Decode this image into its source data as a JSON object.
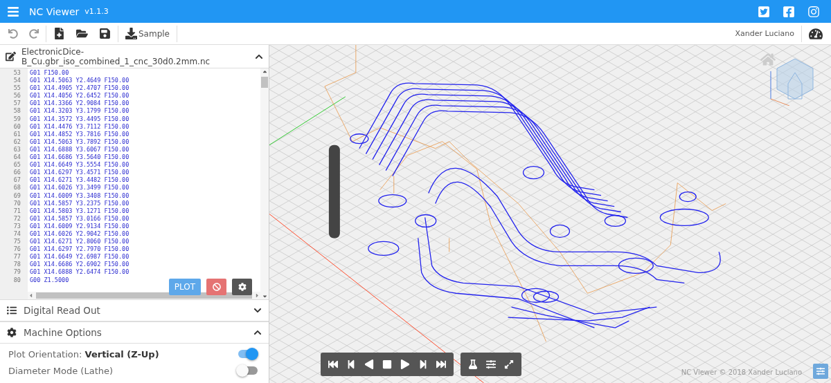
{
  "app_bar": {
    "title": "NC Viewer",
    "version": "v1.1.3"
  },
  "toolbar": {
    "sample_label": "Sample",
    "user": "Xander Luciano"
  },
  "editor": {
    "file_name": "ElectronicDice-B_Cu.gbr_iso_combined_1_cnc_30d0.2mm.nc",
    "plot_button": "PLOT",
    "lines": [
      {
        "number": "53",
        "code": "G01 F150.00"
      },
      {
        "number": "54",
        "code": "G01 X14.5063 Y2.4649 F150.00"
      },
      {
        "number": "55",
        "code": "G01 X14.4905 Y2.4707 F150.00"
      },
      {
        "number": "56",
        "code": "G01 X14.4056 Y2.6452 F150.00"
      },
      {
        "number": "57",
        "code": "G01 X14.3366 Y2.9084 F150.00"
      },
      {
        "number": "58",
        "code": "G01 X14.3203 Y3.1799 F150.00"
      },
      {
        "number": "59",
        "code": "G01 X14.3572 Y3.4495 F150.00"
      },
      {
        "number": "60",
        "code": "G01 X14.4476 Y3.7112 F150.00"
      },
      {
        "number": "61",
        "code": "G01 X14.4852 Y3.7816 F150.00"
      },
      {
        "number": "62",
        "code": "G01 X14.5063 Y3.7892 F150.00"
      },
      {
        "number": "63",
        "code": "G01 X14.6888 Y3.6067 F150.00"
      },
      {
        "number": "64",
        "code": "G01 X14.6686 Y3.5640 F150.00"
      },
      {
        "number": "65",
        "code": "G01 X14.6649 Y3.5554 F150.00"
      },
      {
        "number": "66",
        "code": "G01 X14.6297 Y3.4571 F150.00"
      },
      {
        "number": "67",
        "code": "G01 X14.6271 Y3.4482 F150.00"
      },
      {
        "number": "68",
        "code": "G01 X14.6026 Y3.3499 F150.00"
      },
      {
        "number": "69",
        "code": "G01 X14.6009 Y3.3408 F150.00"
      },
      {
        "number": "70",
        "code": "G01 X14.5857 Y3.2375 F150.00"
      },
      {
        "number": "71",
        "code": "G01 X14.5803 Y3.1271 F150.00"
      },
      {
        "number": "72",
        "code": "G01 X14.5857 Y3.0166 F150.00"
      },
      {
        "number": "73",
        "code": "G01 X14.6009 Y2.9134 F150.00"
      },
      {
        "number": "74",
        "code": "G01 X14.6026 Y2.9042 F150.00"
      },
      {
        "number": "75",
        "code": "G01 X14.6271 Y2.8060 F150.00"
      },
      {
        "number": "76",
        "code": "G01 X14.6297 Y2.7970 F150.00"
      },
      {
        "number": "77",
        "code": "G01 X14.6649 Y2.6987 F150.00"
      },
      {
        "number": "78",
        "code": "G01 X14.6686 Y2.6902 F150.00"
      },
      {
        "number": "79",
        "code": "G01 X14.6888 Y2.6474 F150.00"
      },
      {
        "number": "80",
        "code": "G00 Z1.5000"
      }
    ]
  },
  "panels": [
    {
      "kind": "list",
      "title": "Digital Read Out",
      "expanded": false
    },
    {
      "kind": "settings",
      "title": "Machine Options",
      "expanded": true
    }
  ],
  "options": [
    {
      "label": "Plot Orientation: **Vertical (Z-Up)**",
      "on": true
    },
    {
      "label": "Diameter Mode (Lathe)",
      "on": false
    }
  ],
  "viewer": {
    "footer": "NC Viewer © 2018 Xander Luciano"
  }
}
